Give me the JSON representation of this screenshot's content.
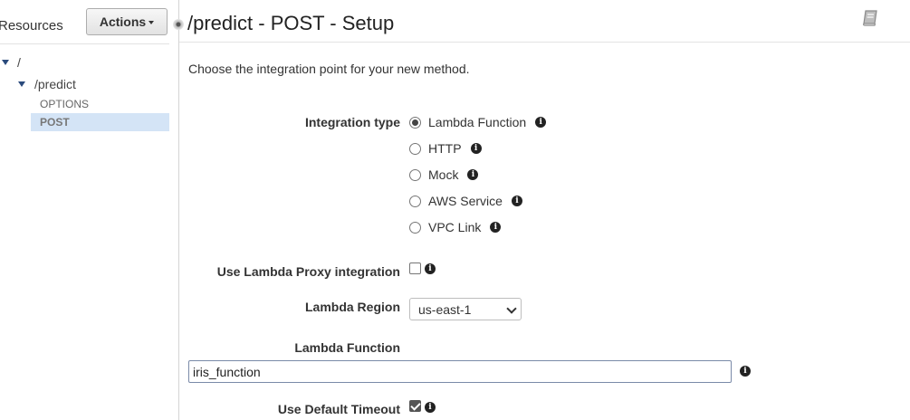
{
  "sidebar": {
    "title": "Resources",
    "actions_label": "Actions",
    "tree": {
      "root": "/",
      "resource": "/predict",
      "methods": [
        "OPTIONS",
        "POST"
      ]
    }
  },
  "main": {
    "title": "/predict - POST - Setup",
    "intro": "Choose the integration point for your new method.",
    "integration_type": {
      "label": "Integration type",
      "options": [
        "Lambda Function",
        "HTTP",
        "Mock",
        "AWS Service",
        "VPC Link"
      ],
      "selected": "Lambda Function"
    },
    "proxy": {
      "label": "Use Lambda Proxy integration",
      "checked": false
    },
    "region": {
      "label": "Lambda Region",
      "value": "us-east-1"
    },
    "function": {
      "label": "Lambda Function",
      "value": "iris_function"
    },
    "timeout": {
      "label": "Use Default Timeout",
      "checked": true
    }
  },
  "icons": {
    "info": "info-icon",
    "book": "book-icon",
    "tree_expand": "triangle-down-icon"
  },
  "colors": {
    "selected_row": "#d4e4f6",
    "tree_triangle": "#2a4a7c"
  }
}
